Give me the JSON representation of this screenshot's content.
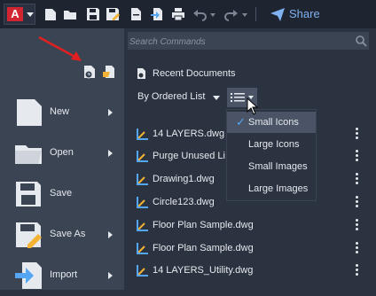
{
  "app": {
    "logo_letter": "A",
    "brand_color": "#d12531"
  },
  "toolbar": {
    "icons": [
      "new-icon",
      "open-icon",
      "save-icon",
      "save-as-icon",
      "print-icon",
      "import-icon",
      "plot-icon",
      "undo-icon",
      "redo-icon",
      "share-icon"
    ],
    "share_label": "Share"
  },
  "search": {
    "placeholder": "Search Commands"
  },
  "left_menu": {
    "items": [
      {
        "label": "New",
        "has_submenu": true
      },
      {
        "label": "Open",
        "has_submenu": true
      },
      {
        "label": "Save",
        "has_submenu": false
      },
      {
        "label": "Save As",
        "has_submenu": true
      },
      {
        "label": "Import",
        "has_submenu": true
      }
    ]
  },
  "recent": {
    "title": "Recent Documents",
    "order_label": "By Ordered List",
    "files": [
      "14 LAYERS.dwg",
      "Purge Unused Li",
      "Drawing1.dwg",
      "Circle123.dwg",
      "Floor Plan Sample.dwg",
      "Floor Plan Sample.dwg",
      "14 LAYERS_Utility.dwg"
    ]
  },
  "view_menu": {
    "options": [
      "Small Icons",
      "Large Icons",
      "Small Images",
      "Large Images"
    ],
    "selected": "Small Icons"
  },
  "colors": {
    "accent": "#55a6f3",
    "annotation_arrow": "#e02020"
  }
}
